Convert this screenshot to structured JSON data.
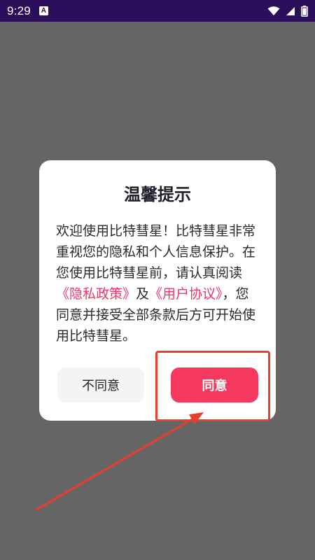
{
  "status_bar": {
    "time": "9:29",
    "badge": "A",
    "icons": [
      "wifi-icon",
      "signal-icon",
      "battery-icon"
    ]
  },
  "dialog": {
    "title": "温馨提示",
    "body_parts": {
      "text1": "欢迎使用比特彗星！比特彗星非常重视您的隐私和个人信息保护。在您使用比特彗星前，请认真阅读",
      "link_privacy": "《隐私政策》",
      "text2": "及",
      "link_user": "《用户协议》",
      "text3": "，您同意并接受全部条款后方可开始使用比特彗星。"
    },
    "buttons": {
      "disagree": "不同意",
      "agree": "同意"
    }
  },
  "colors": {
    "status_bar": "#2a0e5a",
    "overlay": "#656565",
    "link": "#ef3468",
    "agree_button": "#f5395e",
    "annotation": "#e83e2d"
  }
}
